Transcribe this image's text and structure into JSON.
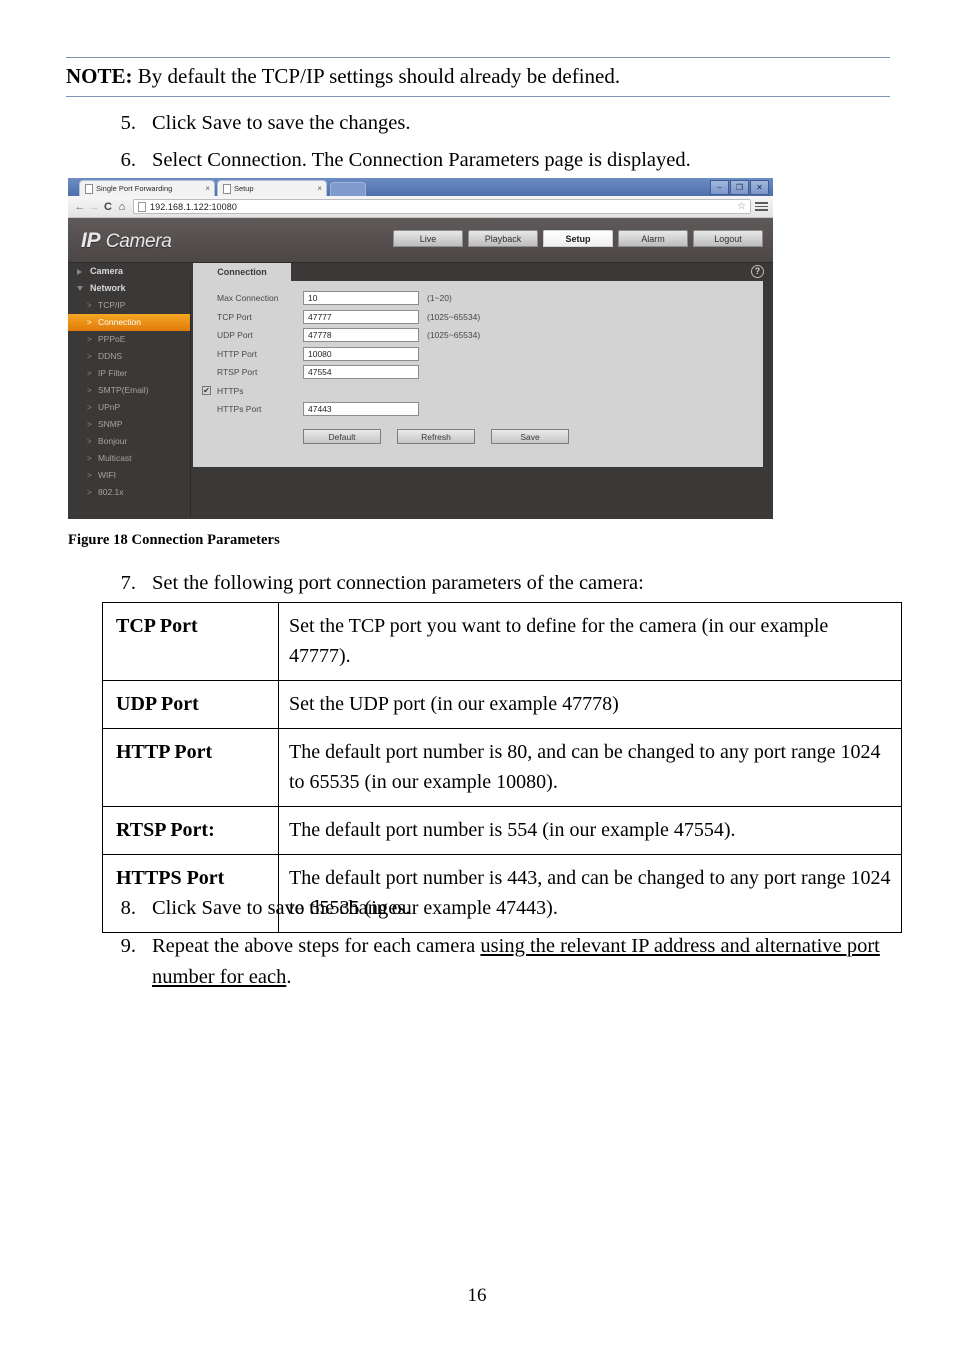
{
  "note": {
    "label": "NOTE:",
    "text": " By default the TCP/IP settings should already be defined."
  },
  "steps": {
    "s5": {
      "num": "5.",
      "text": "Click Save to save the changes."
    },
    "s6": {
      "num": "6.",
      "text": "Select Connection. The Connection Parameters page is displayed."
    },
    "s7": {
      "num": "7.",
      "text": "Set the following port connection parameters of the camera:"
    },
    "s8": {
      "num": "8.",
      "text": "Click Save to save the changes."
    },
    "s9": {
      "num": "9.",
      "text_plain": "Repeat the above steps for each camera ",
      "text_underlined": "using the relevant IP address and alternative port number for each",
      "text_tail": "."
    }
  },
  "figure": {
    "caption": "Figure 18 Connection Parameters"
  },
  "param_table": {
    "rows": [
      {
        "key": "TCP Port",
        "value": "Set the TCP port you want to define for the camera (in our example 47777)."
      },
      {
        "key": "UDP Port",
        "value": "Set the UDP port (in our example 47778)"
      },
      {
        "key": "HTTP Port",
        "value": "The default port number is 80, and can be changed to any port range 1024 to 65535 (in our example 10080)."
      },
      {
        "key": "RTSP Port:",
        "value": "The default port number is 554 (in our example 47554)."
      },
      {
        "key": "HTTPS Port",
        "value": "The default port number is 443, and can be changed to any port range 1024 to 65535 (in our example 47443)."
      }
    ]
  },
  "page_number": "16",
  "screenshot": {
    "browser": {
      "tabs": [
        {
          "title": "Single Port Forwarding",
          "close": "×"
        },
        {
          "title": "Setup",
          "close": "×"
        }
      ],
      "window_controls": [
        {
          "name": "minimize",
          "glyph": "–"
        },
        {
          "name": "restore",
          "glyph": "❐"
        },
        {
          "name": "close",
          "glyph": "✕"
        }
      ],
      "nav": {
        "back": "←",
        "forward": "→",
        "reload": "C",
        "home": "⌂"
      },
      "url": "192.168.1.122:10080",
      "bookmark_star": "☆"
    },
    "app": {
      "logo_bold": "IP",
      "logo_light": "Camera",
      "nav_tabs": [
        {
          "label": "Live",
          "selected": false
        },
        {
          "label": "Playback",
          "selected": false
        },
        {
          "label": "Setup",
          "selected": true
        },
        {
          "label": "Alarm",
          "selected": false
        },
        {
          "label": "Logout",
          "selected": false
        }
      ],
      "sidebar": {
        "groups": [
          {
            "label": "Camera",
            "expanded": false,
            "items": []
          },
          {
            "label": "Network",
            "expanded": true,
            "items": [
              {
                "label": "TCP/IP",
                "active": false
              },
              {
                "label": "Connection",
                "active": true
              },
              {
                "label": "PPPoE",
                "active": false
              },
              {
                "label": "DDNS",
                "active": false
              },
              {
                "label": "IP Filter",
                "active": false
              },
              {
                "label": "SMTP(Email)",
                "active": false
              },
              {
                "label": "UPnP",
                "active": false
              },
              {
                "label": "SNMP",
                "active": false
              },
              {
                "label": "Bonjour",
                "active": false
              },
              {
                "label": "Multicast",
                "active": false
              },
              {
                "label": "WIFI",
                "active": false
              },
              {
                "label": "802.1x",
                "active": false
              }
            ]
          }
        ]
      },
      "panel": {
        "tab_label": "Connection",
        "help_glyph": "?",
        "fields": [
          {
            "label": "Max Connection",
            "value": "10",
            "hint": "(1~20)"
          },
          {
            "label": "TCP Port",
            "value": "47777",
            "hint": "(1025~65534)"
          },
          {
            "label": "UDP Port",
            "value": "47778",
            "hint": "(1025~65534)"
          },
          {
            "label": "HTTP Port",
            "value": "10080",
            "hint": ""
          },
          {
            "label": "RTSP Port",
            "value": "47554",
            "hint": ""
          }
        ],
        "https_checkbox": {
          "label": "HTTPs",
          "checked": true,
          "glyph": "✔"
        },
        "https_port": {
          "label": "HTTPs Port",
          "value": "47443"
        },
        "buttons": [
          {
            "label": "Default"
          },
          {
            "label": "Refresh"
          },
          {
            "label": "Save"
          }
        ]
      }
    },
    "colors": {
      "accent_orange": "#e8840d",
      "chrome_blue": "#5a7ab5",
      "app_dark": "#3b3838",
      "panel_gray": "#d3d3d3"
    }
  }
}
